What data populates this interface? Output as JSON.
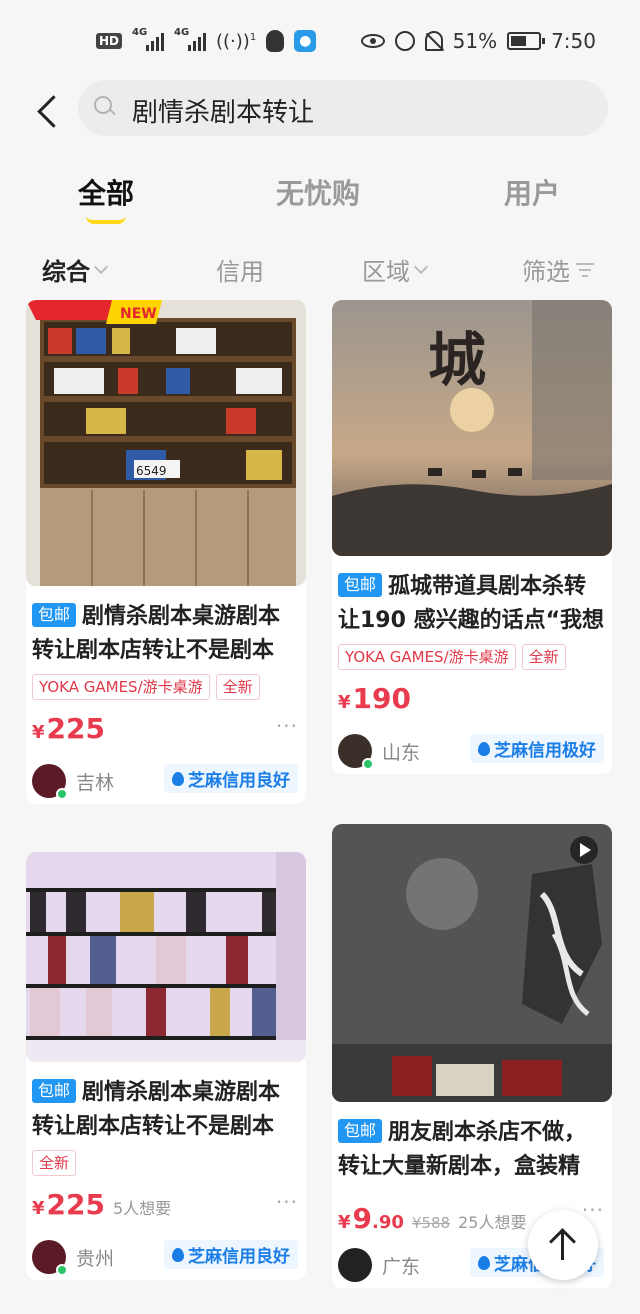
{
  "status_bar": {
    "hd": "HD",
    "sim1": "4G",
    "sim2": "4G",
    "wifi_badge": "1",
    "battery": "51%",
    "time": "7:50"
  },
  "search": {
    "query": "剧情杀剧本转让"
  },
  "tabs": [
    {
      "label": "全部",
      "active": true
    },
    {
      "label": "无忧购",
      "active": false
    },
    {
      "label": "用户",
      "active": false
    }
  ],
  "filters": [
    {
      "label": "综合",
      "active": true
    },
    {
      "label": "信用",
      "active": false
    },
    {
      "label": "区域",
      "active": false
    },
    {
      "label": "筛选",
      "active": false
    }
  ],
  "items": [
    {
      "badge": "包邮",
      "title": "剧情杀剧本桌游剧本转让剧本店转让不是剧本",
      "tags": [
        "YOKA GAMES/游卡桌游",
        "全新"
      ],
      "price": "225",
      "wants": "",
      "original_price": "",
      "location": "吉林",
      "credit": "芝麻信用良好",
      "image_caption": "NEW",
      "shelf_number": "6549"
    },
    {
      "badge": "包邮",
      "title": "孤城带道具剧本杀转让190 感兴趣的话点“我想",
      "tags": [
        "YOKA GAMES/游卡桌游",
        "全新"
      ],
      "price": "190",
      "wants": "",
      "original_price": "",
      "location": "山东",
      "credit": "芝麻信用极好",
      "image_caption": "城"
    },
    {
      "badge": "包邮",
      "title": "剧情杀剧本桌游剧本转让剧本店转让不是剧本",
      "tags": [
        "全新"
      ],
      "price": "225",
      "wants": "5人想要",
      "original_price": "",
      "location": "贵州",
      "credit": "芝麻信用良好"
    },
    {
      "badge": "包邮",
      "title": "朋友剧本杀店不做，转让大量新剧本，盒装精",
      "tags": [],
      "price_int": "9",
      "price_dec": ".90",
      "original_price": "¥588",
      "wants": "25人想要",
      "location": "广东",
      "credit": "芝麻信用极好"
    }
  ],
  "currency": "¥",
  "more": "···",
  "colors": {
    "accent_yellow": "#ffd91a",
    "price_red": "#e83b4d",
    "badge_blue": "#2196f3",
    "credit_blue": "#1b7ee6"
  }
}
